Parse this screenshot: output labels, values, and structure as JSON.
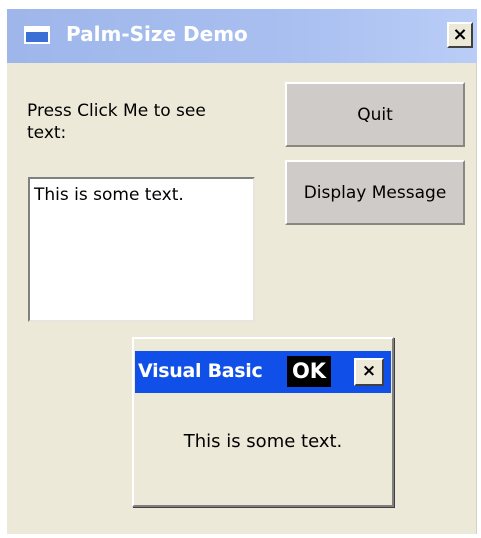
{
  "window": {
    "title": "Palm-Size Demo",
    "close_label": "×",
    "title_color": "#a9bff0"
  },
  "form": {
    "prompt_text": "Press Click Me to see text:",
    "textbox_value": "This is some text.",
    "quit_label": "Quit",
    "display_message_label": "Display Message"
  },
  "message_box": {
    "title": "Visual Basic",
    "ok_label": "OK",
    "close_label": "×",
    "message": "This is some text.",
    "title_color": "#1150e8"
  }
}
